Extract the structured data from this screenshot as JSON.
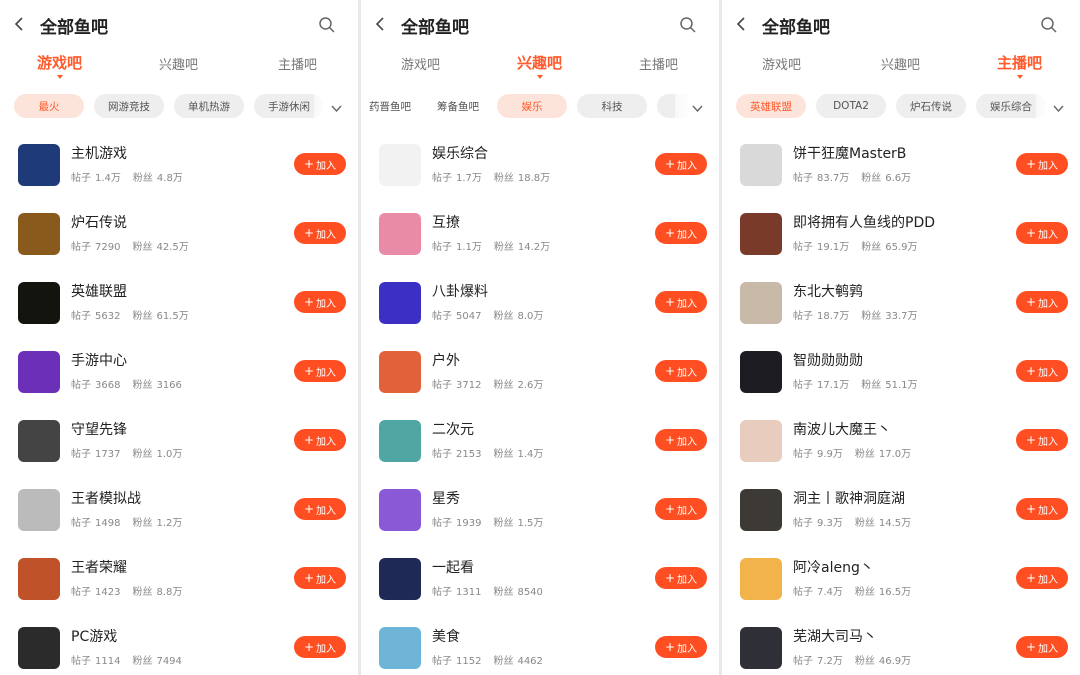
{
  "screens": [
    {
      "title": "全部鱼吧",
      "tabs": [
        {
          "label": "游戏吧",
          "active": true
        },
        {
          "label": "兴趣吧",
          "active": false
        },
        {
          "label": "主播吧",
          "active": false
        }
      ],
      "chips": [
        {
          "label": "最火",
          "active": true
        },
        {
          "label": "网游竞技",
          "active": false
        },
        {
          "label": "单机热游",
          "active": false
        },
        {
          "label": "手游休闲",
          "active": false
        }
      ],
      "items": [
        {
          "name": "主机游戏",
          "posts_label": "帖子",
          "posts": "1.4万",
          "fans_label": "粉丝",
          "fans": "4.8万",
          "avatar": "gamepad-icon",
          "color": "#1f3a78"
        },
        {
          "name": "炉石传说",
          "posts_label": "帖子",
          "posts": "7290",
          "fans_label": "粉丝",
          "fans": "42.5万",
          "avatar": "hearthstone-logo",
          "color": "#8a5a1c"
        },
        {
          "name": "英雄联盟",
          "posts_label": "帖子",
          "posts": "5632",
          "fans_label": "粉丝",
          "fans": "61.5万",
          "avatar": "lol-logo",
          "color": "#14140f"
        },
        {
          "name": "手游中心",
          "posts_label": "帖子",
          "posts": "3668",
          "fans_label": "粉丝",
          "fans": "3166",
          "avatar": "mobile-games-logo",
          "color": "#6b2fb8"
        },
        {
          "name": "守望先锋",
          "posts_label": "帖子",
          "posts": "1737",
          "fans_label": "粉丝",
          "fans": "1.0万",
          "avatar": "overwatch-logo",
          "color": "#444444"
        },
        {
          "name": "王者模拟战",
          "posts_label": "帖子",
          "posts": "1498",
          "fans_label": "粉丝",
          "fans": "1.2万",
          "avatar": "kings-sim-logo",
          "color": "#bbbbbb"
        },
        {
          "name": "王者荣耀",
          "posts_label": "帖子",
          "posts": "1423",
          "fans_label": "粉丝",
          "fans": "8.8万",
          "avatar": "kings-glory-logo",
          "color": "#c0522a"
        },
        {
          "name": "PC游戏",
          "posts_label": "帖子",
          "posts": "1114",
          "fans_label": "粉丝",
          "fans": "7494",
          "avatar": "vr-headset-icon",
          "color": "#2b2b2b"
        }
      ],
      "join_label": "加入"
    },
    {
      "title": "全部鱼吧",
      "tabs": [
        {
          "label": "游戏吧",
          "active": false
        },
        {
          "label": "兴趣吧",
          "active": true
        },
        {
          "label": "主播吧",
          "active": false
        }
      ],
      "chips": [
        {
          "label": "药晋鱼吧",
          "active": false,
          "plain": true
        },
        {
          "label": "筹备鱼吧",
          "active": false,
          "plain": true
        },
        {
          "label": "娱乐",
          "active": true
        },
        {
          "label": "科技",
          "active": false
        },
        {
          "label": "",
          "active": false
        }
      ],
      "items": [
        {
          "name": "娱乐综合",
          "posts_label": "帖子",
          "posts": "1.7万",
          "fans_label": "粉丝",
          "fans": "18.8万",
          "avatar": "meme-face-icon",
          "color": "#f2f2f2"
        },
        {
          "name": "互撩",
          "posts_label": "帖子",
          "posts": "1.1万",
          "fans_label": "粉丝",
          "fans": "14.2万",
          "avatar": "anime-girl-avatar",
          "color": "#e98aa6"
        },
        {
          "name": "八卦爆料",
          "posts_label": "帖子",
          "posts": "5047",
          "fans_label": "粉丝",
          "fans": "8.0万",
          "avatar": "gossip-logo",
          "color": "#3b2fc4"
        },
        {
          "name": "户外",
          "posts_label": "帖子",
          "posts": "3712",
          "fans_label": "粉丝",
          "fans": "2.6万",
          "avatar": "outdoor-avatar",
          "color": "#e0613a"
        },
        {
          "name": "二次元",
          "posts_label": "帖子",
          "posts": "2153",
          "fans_label": "粉丝",
          "fans": "1.4万",
          "avatar": "miku-avatar",
          "color": "#4fa6a2"
        },
        {
          "name": "星秀",
          "posts_label": "帖子",
          "posts": "1939",
          "fans_label": "粉丝",
          "fans": "1.5万",
          "avatar": "star-show-avatar",
          "color": "#8a5ad6"
        },
        {
          "name": "一起看",
          "posts_label": "帖子",
          "posts": "1311",
          "fans_label": "粉丝",
          "fans": "8540",
          "avatar": "watch-together-logo",
          "color": "#1e2a55"
        },
        {
          "name": "美食",
          "posts_label": "帖子",
          "posts": "1152",
          "fans_label": "粉丝",
          "fans": "4462",
          "avatar": "food-avatar",
          "color": "#6fb5d8"
        }
      ],
      "join_label": "加入"
    },
    {
      "title": "全部鱼吧",
      "tabs": [
        {
          "label": "游戏吧",
          "active": false
        },
        {
          "label": "兴趣吧",
          "active": false
        },
        {
          "label": "主播吧",
          "active": true
        }
      ],
      "chips": [
        {
          "label": "英雄联盟",
          "active": true
        },
        {
          "label": "DOTA2",
          "active": false
        },
        {
          "label": "炉石传说",
          "active": false
        },
        {
          "label": "娱乐综合",
          "active": false
        }
      ],
      "items": [
        {
          "name": "饼干狂魔MasterB",
          "posts_label": "帖子",
          "posts": "83.7万",
          "fans_label": "粉丝",
          "fans": "6.6万",
          "avatar": "streamer-avatar",
          "color": "#d9d9d9"
        },
        {
          "name": "即将拥有人鱼线的PDD",
          "posts_label": "帖子",
          "posts": "19.1万",
          "fans_label": "粉丝",
          "fans": "65.9万",
          "avatar": "streamer-avatar",
          "color": "#7a3a2a"
        },
        {
          "name": "东北大鹌鹑",
          "posts_label": "帖子",
          "posts": "18.7万",
          "fans_label": "粉丝",
          "fans": "33.7万",
          "avatar": "streamer-avatar",
          "color": "#c9b9a8"
        },
        {
          "name": "智勋勋勋勋",
          "posts_label": "帖子",
          "posts": "17.1万",
          "fans_label": "粉丝",
          "fans": "51.1万",
          "avatar": "streamer-avatar",
          "color": "#1c1c22"
        },
        {
          "name": "南波儿大魔王丶",
          "posts_label": "帖子",
          "posts": "9.9万",
          "fans_label": "粉丝",
          "fans": "17.0万",
          "avatar": "streamer-avatar",
          "color": "#e8cdbf"
        },
        {
          "name": "洞主丨歌神洞庭湖",
          "posts_label": "帖子",
          "posts": "9.3万",
          "fans_label": "粉丝",
          "fans": "14.5万",
          "avatar": "streamer-avatar",
          "color": "#3d3a36"
        },
        {
          "name": "阿冷aleng丶",
          "posts_label": "帖子",
          "posts": "7.4万",
          "fans_label": "粉丝",
          "fans": "16.5万",
          "avatar": "streamer-avatar",
          "color": "#f2b44a"
        },
        {
          "name": "芜湖大司马丶",
          "posts_label": "帖子",
          "posts": "7.2万",
          "fans_label": "粉丝",
          "fans": "46.9万",
          "avatar": "streamer-avatar",
          "color": "#2f2f38"
        }
      ],
      "join_label": "加入"
    }
  ],
  "colors": {
    "accent": "#ff5a2c",
    "chip_active_bg": "#fde4da",
    "join_bg": "#ff4f22"
  }
}
